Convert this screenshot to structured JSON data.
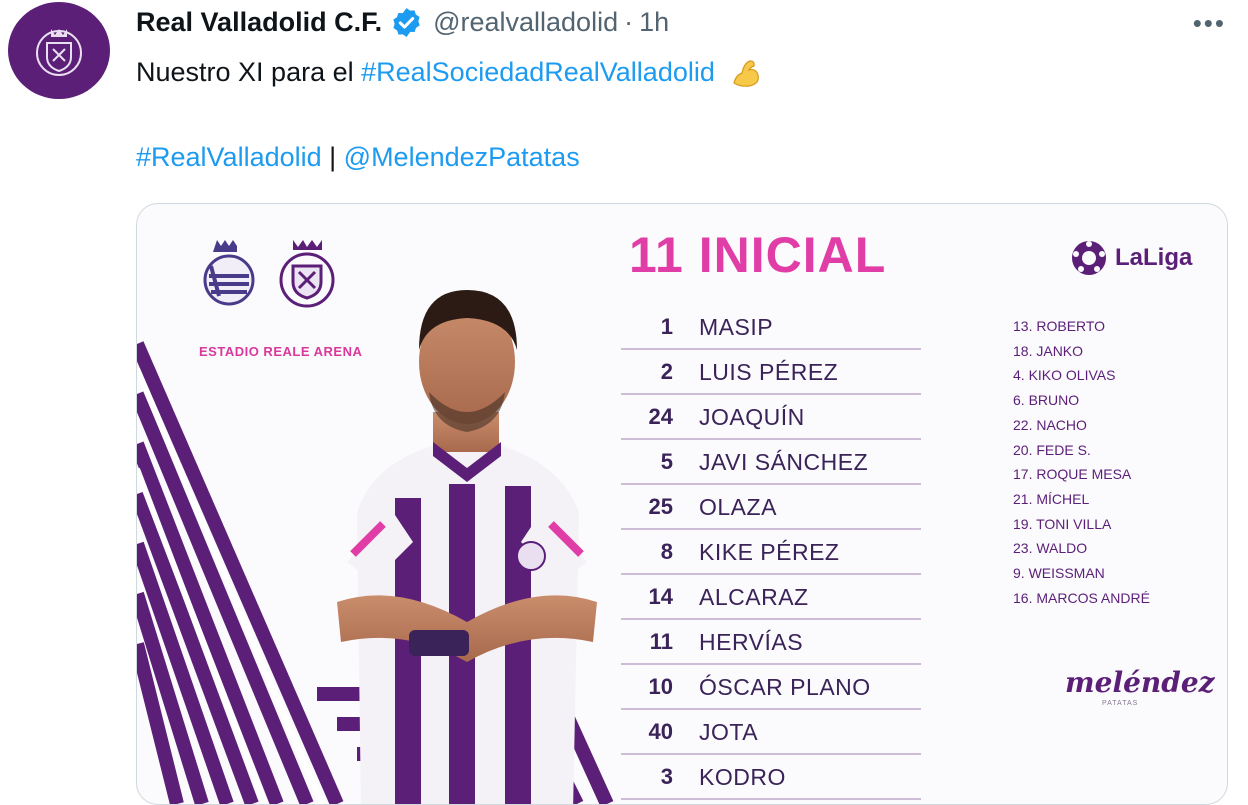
{
  "tweet": {
    "author_name": "Real Valladolid C.F.",
    "handle": "@realvalladolid",
    "separator": "·",
    "time": "1h",
    "more_label": "•••",
    "text_prefix": "Nuestro XI para el ",
    "hashtag_main": "#RealSociedadRealValladolid",
    "hashtag_2": "#RealValladolid",
    "divider": " | ",
    "mention": "@MelendezPatatas"
  },
  "image": {
    "title": "11 INICIAL",
    "stadium": "ESTADIO REALE ARENA",
    "league": "LaLiga",
    "sponsor": "meléndez",
    "sponsor_sub": "PATATAS",
    "lineup": [
      {
        "number": "1",
        "name": "MASIP"
      },
      {
        "number": "2",
        "name": "LUIS PÉREZ"
      },
      {
        "number": "24",
        "name": "JOAQUÍN"
      },
      {
        "number": "5",
        "name": "JAVI SÁNCHEZ"
      },
      {
        "number": "25",
        "name": "OLAZA"
      },
      {
        "number": "8",
        "name": "KIKE PÉREZ"
      },
      {
        "number": "14",
        "name": "ALCARAZ"
      },
      {
        "number": "11",
        "name": "HERVÍAS"
      },
      {
        "number": "10",
        "name": "ÓSCAR PLANO"
      },
      {
        "number": "40",
        "name": "JOTA"
      },
      {
        "number": "3",
        "name": "KODRO"
      }
    ],
    "substitutes": [
      "13. ROBERTO",
      "18. JANKO",
      "4. KIKO OLIVAS",
      "6. BRUNO",
      "22. NACHO",
      "20. FEDE S.",
      "17. ROQUE MESA",
      "21. MÍCHEL",
      "19. TONI VILLA",
      "23. WALDO",
      "9. WEISSMAN",
      "16. MARCOS ANDRÉ"
    ]
  },
  "colors": {
    "link": "#1d9bf0",
    "club_purple": "#5b1f78",
    "title_pink": "#e03ea6"
  }
}
